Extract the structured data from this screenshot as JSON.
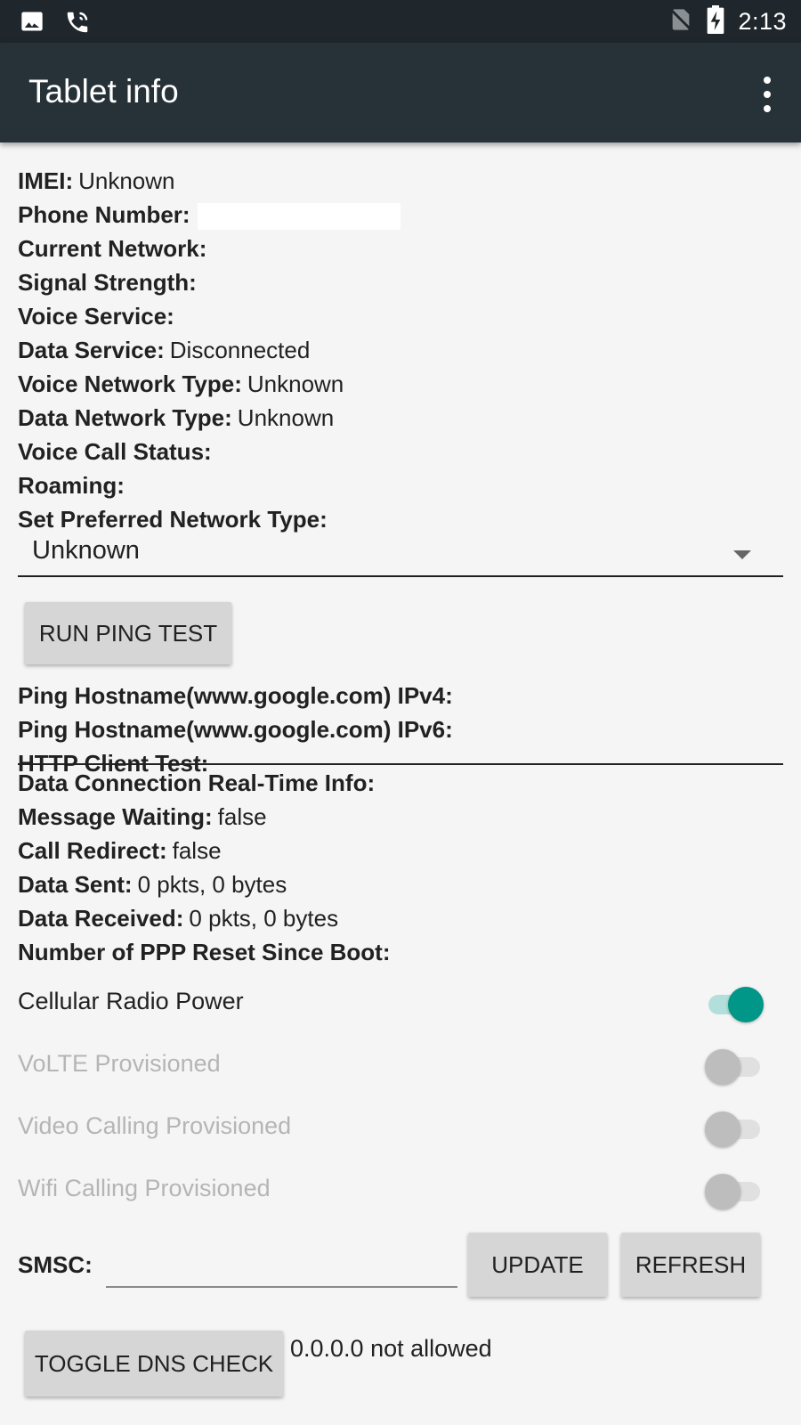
{
  "status_bar": {
    "time": "2:13",
    "left_icons": [
      "image-icon",
      "wifi-calling-icon"
    ],
    "right_icons": [
      "no-sim-icon",
      "battery-charging-icon"
    ]
  },
  "app_bar": {
    "title": "Tablet info",
    "menu_icon": "overflow-menu-icon"
  },
  "info": {
    "imei": {
      "label": "IMEI:",
      "value": "Unknown"
    },
    "phone_number": {
      "label": "Phone Number:",
      "value": ""
    },
    "current_network": {
      "label": "Current Network:",
      "value": ""
    },
    "signal_strength": {
      "label": "Signal Strength:",
      "value": ""
    },
    "voice_service": {
      "label": "Voice Service:",
      "value": ""
    },
    "data_service": {
      "label": "Data Service:",
      "value": "Disconnected"
    },
    "voice_network_type": {
      "label": "Voice Network Type:",
      "value": "Unknown"
    },
    "data_network_type": {
      "label": "Data Network Type:",
      "value": "Unknown"
    },
    "voice_call_status": {
      "label": "Voice Call Status:",
      "value": ""
    },
    "roaming": {
      "label": "Roaming:",
      "value": ""
    },
    "preferred_network": {
      "label": "Set Preferred Network Type:",
      "selected": "Unknown"
    }
  },
  "ping": {
    "button_label": "RUN PING TEST",
    "ipv4": {
      "label": "Ping Hostname(www.google.com) IPv4:",
      "value": ""
    },
    "ipv6": {
      "label": "Ping Hostname(www.google.com) IPv6:",
      "value": ""
    },
    "http": {
      "label": "HTTP Client Test:",
      "value": ""
    }
  },
  "data": {
    "realtime": {
      "label": "Data Connection Real-Time Info:",
      "value": ""
    },
    "message_waiting": {
      "label": "Message Waiting:",
      "value": "false"
    },
    "call_redirect": {
      "label": "Call Redirect:",
      "value": "false"
    },
    "data_sent": {
      "label": "Data Sent:",
      "value": "0 pkts, 0 bytes"
    },
    "data_received": {
      "label": "Data Received:",
      "value": "0 pkts, 0 bytes"
    },
    "ppp_reset": {
      "label": "Number of PPP Reset Since Boot:",
      "value": ""
    }
  },
  "switches": {
    "cellular_radio": {
      "label": "Cellular Radio Power",
      "on": true,
      "enabled": true
    },
    "volte": {
      "label": "VoLTE Provisioned",
      "on": false,
      "enabled": false
    },
    "video_calling": {
      "label": "Video Calling Provisioned",
      "on": false,
      "enabled": false
    },
    "wifi_calling": {
      "label": "Wifi Calling Provisioned",
      "on": false,
      "enabled": false
    }
  },
  "smsc": {
    "label": "SMSC:",
    "value": "",
    "update_label": "UPDATE",
    "refresh_label": "REFRESH"
  },
  "dns": {
    "button_label": "TOGGLE DNS CHECK",
    "status": "0.0.0.0 not allowed"
  },
  "colors": {
    "status_bar": "#1f272c",
    "app_bar": "#263238",
    "accent": "#009688",
    "background": "#f5f5f5"
  }
}
